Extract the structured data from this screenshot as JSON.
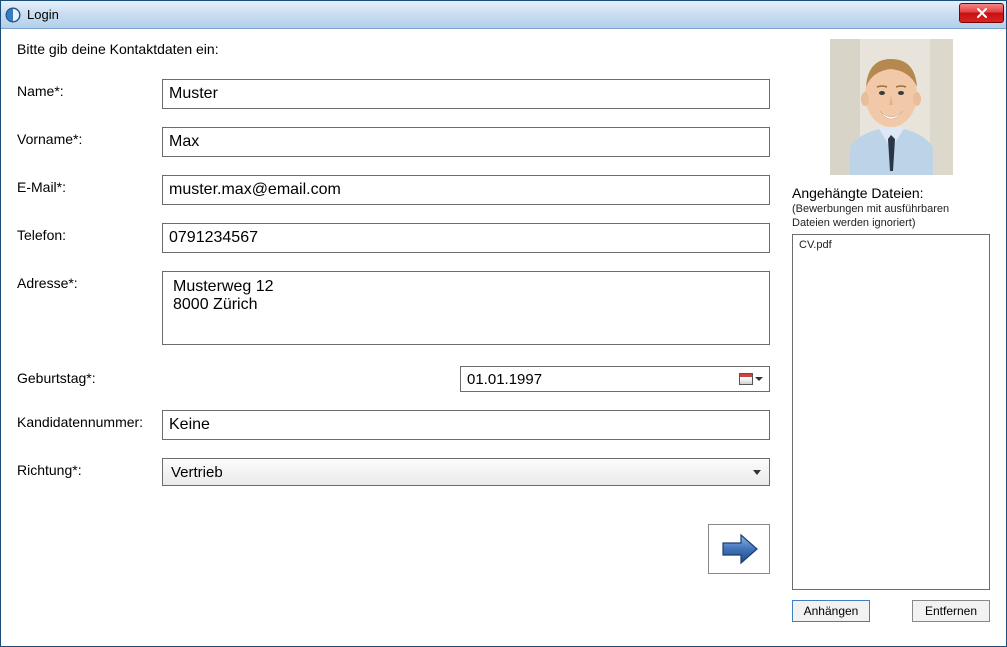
{
  "window": {
    "title": "Login"
  },
  "form": {
    "intro": "Bitte gib deine Kontaktdaten ein:",
    "labels": {
      "name": "Name*:",
      "vorname": "Vorname*:",
      "email": "E-Mail*:",
      "telefon": "Telefon:",
      "adresse": "Adresse*:",
      "geburtstag": "Geburtstag*:",
      "kandidatennummer": "Kandidatennummer:",
      "richtung": "Richtung*:"
    },
    "values": {
      "name": "Muster",
      "vorname": "Max",
      "email": "muster.max@email.com",
      "telefon": "0791234567",
      "adresse": "Musterweg 12\n8000 Zürich",
      "geburtstag": "01.01.1997",
      "kandidatennummer": "Keine",
      "richtung": "Vertrieb"
    }
  },
  "sidebar": {
    "attach_title": "Angehängte Dateien:",
    "attach_sub": "(Bewerbungen mit ausführbaren Dateien werden ignoriert)",
    "files": [
      "CV.pdf"
    ],
    "attach_btn": "Anhängen",
    "remove_btn": "Entfernen"
  }
}
